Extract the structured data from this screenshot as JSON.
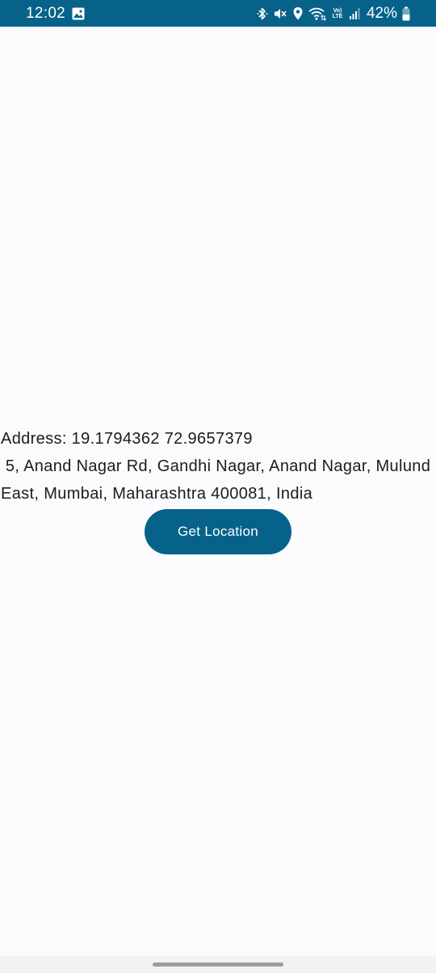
{
  "status_bar": {
    "time": "12:02",
    "battery_percent": "42%",
    "network_badge_top": "Vo)",
    "network_badge_bottom": "LTE",
    "icons": [
      "gallery-icon",
      "bluetooth-icon",
      "mute-icon",
      "location-icon",
      "wifi-icon",
      "lte-icon",
      "signal-icon",
      "battery-icon"
    ],
    "background_color": "#07628a"
  },
  "main": {
    "address_text": "Address: 19.1794362 72.9657379\n 5, Anand Nagar Rd, Gandhi Nagar, Anand Nagar, Mulund East, Mumbai, Maharashtra 400081, India",
    "button_label": "Get Location",
    "button_color": "#07628a"
  }
}
